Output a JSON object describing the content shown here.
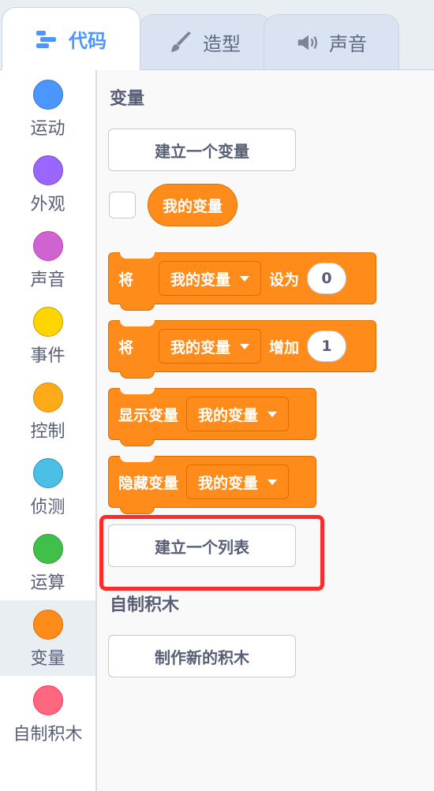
{
  "tabs": [
    {
      "label": "代码",
      "icon": "code-icon",
      "active": true
    },
    {
      "label": "造型",
      "icon": "brush-icon",
      "active": false
    },
    {
      "label": "声音",
      "icon": "speaker-icon",
      "active": false
    }
  ],
  "categories": [
    {
      "label": "运动",
      "color": "#4c97ff",
      "border": "#3373cc"
    },
    {
      "label": "外观",
      "color": "#9966ff",
      "border": "#774dcb"
    },
    {
      "label": "声音",
      "color": "#cf63cf",
      "border": "#bd42bd"
    },
    {
      "label": "事件",
      "color": "#ffd500",
      "border": "#cc9900"
    },
    {
      "label": "控制",
      "color": "#ffab19",
      "border": "#cf8b17"
    },
    {
      "label": "侦测",
      "color": "#4cbfe6",
      "border": "#2e8eb8"
    },
    {
      "label": "运算",
      "color": "#40bf4a",
      "border": "#389438"
    },
    {
      "label": "变量",
      "color": "#ff8c1a",
      "border": "#db6e00"
    },
    {
      "label": "自制积木",
      "color": "#ff6680",
      "border": "#ff3355"
    }
  ],
  "selected_category": "变量",
  "palette": {
    "variables_title": "变量",
    "make_variable_button": "建立一个变量",
    "variable_reporter": "我的变量",
    "set_block": {
      "prefix": "将",
      "dropdown": "我的变量",
      "verb": "设为",
      "value": "0"
    },
    "change_block": {
      "prefix": "将",
      "dropdown": "我的变量",
      "verb": "增加",
      "value": "1"
    },
    "show_block": {
      "label": "显示变量",
      "dropdown": "我的变量"
    },
    "hide_block": {
      "label": "隐藏变量",
      "dropdown": "我的变量"
    },
    "make_list_button": "建立一个列表",
    "my_blocks_title": "自制积木",
    "make_block_button": "制作新的积木"
  },
  "colors": {
    "accent": "#4c97ff",
    "variables": "#ff8c1a",
    "highlight": "#ff2a2a"
  }
}
